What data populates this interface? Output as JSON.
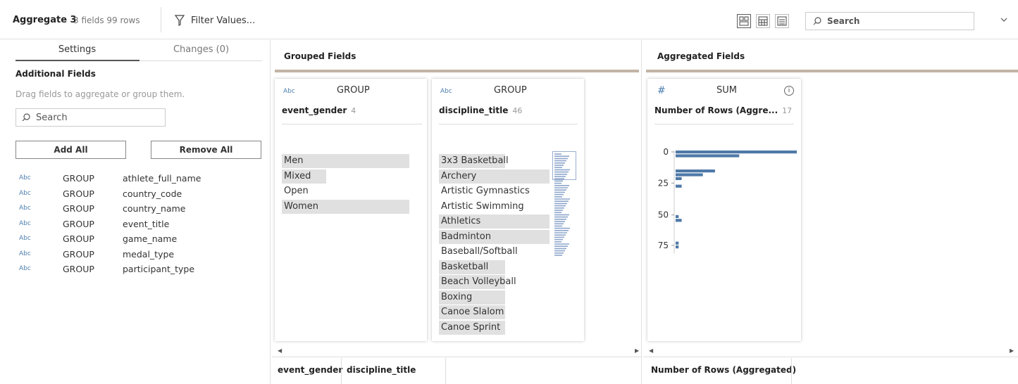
{
  "toolbar": {
    "title": "Aggregate 3",
    "meta": "3 fields 99 rows",
    "filter_label": "Filter Values...",
    "search_placeholder": "Search"
  },
  "left": {
    "tabs": [
      {
        "label": "Settings"
      },
      {
        "label": "Changes (0)"
      }
    ],
    "section_title": "Additional Fields",
    "hint": "Drag fields to aggregate or group them.",
    "search_placeholder": "Search",
    "add_all": "Add All",
    "remove_all": "Remove All",
    "fields": [
      {
        "type": "Abc",
        "agg": "GROUP",
        "name": "athlete_full_name"
      },
      {
        "type": "Abc",
        "agg": "GROUP",
        "name": "country_code"
      },
      {
        "type": "Abc",
        "agg": "GROUP",
        "name": "country_name"
      },
      {
        "type": "Abc",
        "agg": "GROUP",
        "name": "event_title"
      },
      {
        "type": "Abc",
        "agg": "GROUP",
        "name": "game_name"
      },
      {
        "type": "Abc",
        "agg": "GROUP",
        "name": "medal_type"
      },
      {
        "type": "Abc",
        "agg": "GROUP",
        "name": "participant_type"
      }
    ]
  },
  "grouped": {
    "title": "Grouped Fields",
    "cards": [
      {
        "type": "Abc",
        "agg": "GROUP",
        "name": "event_gender",
        "count": "4",
        "values": [
          {
            "label": "Men",
            "fill": 1.0
          },
          {
            "label": "Mixed",
            "fill": 0.35
          },
          {
            "label": "Open",
            "fill": 0.0
          },
          {
            "label": "Women",
            "fill": 1.0
          }
        ]
      },
      {
        "type": "Abc",
        "agg": "GROUP",
        "name": "discipline_title",
        "count": "46",
        "values": [
          {
            "label": "3x3 Basketball",
            "fill": 0.6
          },
          {
            "label": "Archery",
            "fill": 1.0
          },
          {
            "label": "Artistic Gymnastics",
            "fill": 0.0
          },
          {
            "label": "Artistic Swimming",
            "fill": 0.0
          },
          {
            "label": "Athletics",
            "fill": 1.0
          },
          {
            "label": "Badminton",
            "fill": 1.0
          },
          {
            "label": "Baseball/Softball",
            "fill": 0.0
          },
          {
            "label": "Basketball",
            "fill": 0.6
          },
          {
            "label": "Beach Volleyball",
            "fill": 0.6
          },
          {
            "label": "Boxing",
            "fill": 0.6
          },
          {
            "label": "Canoe Slalom",
            "fill": 0.6
          },
          {
            "label": "Canoe Sprint",
            "fill": 0.6
          }
        ]
      }
    ],
    "columns": [
      "event_gender",
      "discipline_title"
    ]
  },
  "aggregated": {
    "title": "Aggregated Fields",
    "card": {
      "agg": "SUM",
      "name": "Number of Rows (Aggre...",
      "count": "17"
    },
    "ticks": [
      "0",
      "25",
      "50",
      "75"
    ],
    "column": "Number of Rows (Aggregated)"
  },
  "chart_data": {
    "type": "bar",
    "orientation": "horizontal",
    "bins": [
      "0",
      "",
      "",
      "",
      "",
      "",
      "",
      "",
      "25",
      "",
      "",
      "",
      "",
      "",
      "",
      "",
      "50",
      "",
      "",
      "",
      "",
      "",
      "",
      "",
      "75"
    ],
    "values": [
      40,
      21,
      0,
      0,
      0,
      13,
      9,
      2,
      0,
      2,
      0,
      0,
      0,
      0,
      0,
      0,
      0,
      1,
      2,
      0,
      0,
      0,
      0,
      0,
      1,
      1
    ],
    "ylim": [
      0,
      90
    ]
  },
  "colors": {
    "accent_bar": "#4e79a7",
    "panel_header": "#c2b4a6",
    "type_icon": "#4d7fb0"
  }
}
